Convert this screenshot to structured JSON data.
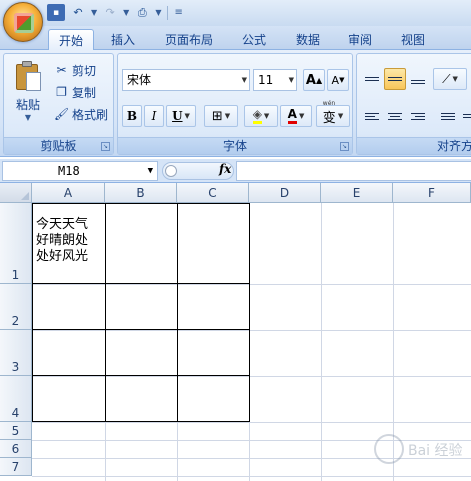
{
  "ribbon": {
    "tabs": [
      "开始",
      "插入",
      "页面布局",
      "公式",
      "数据",
      "审阅",
      "视图"
    ],
    "active_tab": "开始",
    "clipboard": {
      "paste": "粘贴",
      "cut": "剪切",
      "copy": "复制",
      "format_painter": "格式刷",
      "group_label": "剪贴板"
    },
    "font": {
      "font_name": "宋体",
      "font_size": "11",
      "grow_label": "A",
      "shrink_label": "A",
      "bold": "B",
      "italic": "I",
      "underline": "U",
      "font_color_label": "A",
      "phonetic_label": "变",
      "phonetic_small": "wén",
      "group_label": "字体"
    },
    "alignment": {
      "group_label": "对齐方"
    }
  },
  "formula_bar": {
    "name_box": "M18",
    "fx": "fx",
    "content": ""
  },
  "sheet": {
    "columns": [
      "A",
      "B",
      "C",
      "D",
      "E",
      "F"
    ],
    "rows": [
      "1",
      "2",
      "3",
      "4",
      "5",
      "6",
      "7"
    ],
    "cell_A1": [
      "今天天气",
      "好晴朗处",
      "处好风光"
    ]
  },
  "watermark": {
    "text": "Bai 经验"
  },
  "colors": {
    "ribbon_bg": "#d5e4f7",
    "tab_text": "#15428b",
    "active_align": "#f9c65a"
  }
}
